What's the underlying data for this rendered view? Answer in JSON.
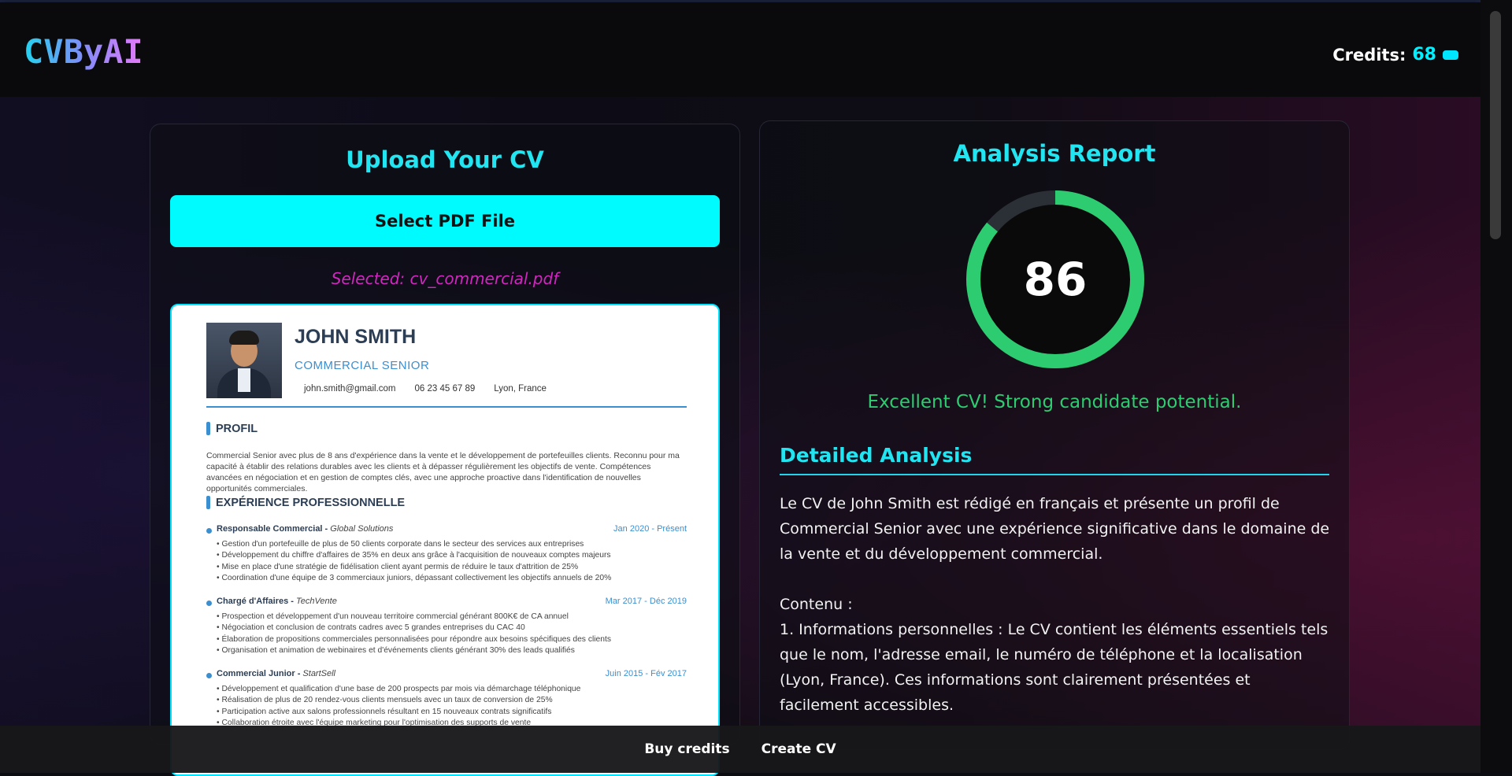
{
  "header": {
    "logo": "CVByAI",
    "credits_label": "Credits:",
    "credits_value": "68",
    "credits_icon": "coin-icon"
  },
  "upload": {
    "title": "Upload Your CV",
    "select_button": "Select PDF File",
    "selected_file": "Selected: cv_commercial.pdf"
  },
  "cv": {
    "name": "JOHN SMITH",
    "role": "COMMERCIAL SENIOR",
    "email": "john.smith@gmail.com",
    "phone": "06 23 45 67 89",
    "location": "Lyon, France",
    "profile_title": "PROFIL",
    "profile_text": "Commercial Senior avec plus de 8 ans d'expérience dans la vente et le développement de portefeuilles clients. Reconnu pour ma capacité à établir des relations durables avec les clients et à dépasser régulièrement les objectifs de vente. Compétences avancées en négociation et en gestion de comptes clés, avec une approche proactive dans l'identification de nouvelles opportunités commerciales.",
    "experience_title": "EXPÉRIENCE PROFESSIONNELLE",
    "jobs": [
      {
        "title": "Responsable Commercial",
        "company": "Global Solutions",
        "dates": "Jan 2020 - Présent",
        "bullets": [
          "Gestion d'un portefeuille de plus de 50 clients corporate dans le secteur des services aux entreprises",
          "Développement du chiffre d'affaires de 35% en deux ans grâce à l'acquisition de nouveaux comptes majeurs",
          "Mise en place d'une stratégie de fidélisation client ayant permis de réduire le taux d'attrition de 25%",
          "Coordination d'une équipe de 3 commerciaux juniors, dépassant collectivement les objectifs annuels de 20%"
        ]
      },
      {
        "title": "Chargé d'Affaires",
        "company": "TechVente",
        "dates": "Mar 2017 - Déc 2019",
        "bullets": [
          "Prospection et développement d'un nouveau territoire commercial générant 800K€ de CA annuel",
          "Négociation et conclusion de contrats cadres avec 5 grandes entreprises du CAC 40",
          "Élaboration de propositions commerciales personnalisées pour répondre aux besoins spécifiques des clients",
          "Organisation et animation de webinaires et d'événements clients générant 30% des leads qualifiés"
        ]
      },
      {
        "title": "Commercial Junior",
        "company": "StartSell",
        "dates": "Juin 2015 - Fév 2017",
        "bullets": [
          "Développement et qualification d'une base de 200 prospects par mois via démarchage téléphonique",
          "Réalisation de plus de 20 rendez-vous clients mensuels avec un taux de conversion de 25%",
          "Participation active aux salons professionnels résultant en 15 nouveaux contrats significatifs",
          "Collaboration étroite avec l'équipe marketing pour l'optimisation des supports de vente"
        ]
      }
    ]
  },
  "report": {
    "title": "Analysis Report",
    "score": 86,
    "score_max": 100,
    "score_color": "#2ecc71",
    "track_color": "#2b2f36",
    "verdict": "Excellent CV! Strong candidate potential.",
    "detail_title": "Detailed Analysis",
    "paragraph_1": "Le CV de John Smith est rédigé en français et présente un profil de Commercial Senior avec une expérience significative dans le domaine de la vente et du développement commercial.",
    "contenu_label": "Contenu :",
    "paragraph_2": "1. Informations personnelles : Le CV contient les éléments essentiels tels que le nom, l'adresse email, le numéro de téléphone et la localisation (Lyon, France). Ces informations sont clairement présentées et facilement accessibles."
  },
  "footer": {
    "buy_credits": "Buy credits",
    "create_cv": "Create CV"
  }
}
